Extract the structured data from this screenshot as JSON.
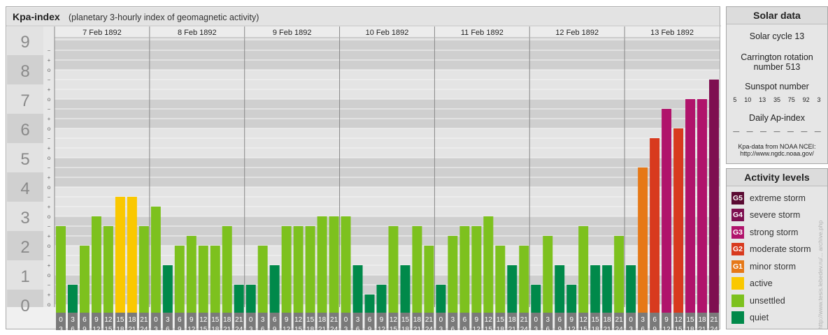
{
  "header": {
    "title": "Kpa-index",
    "subtitle": "(planetary 3-hourly index of geomagnetic activity)"
  },
  "solar_panel": {
    "title": "Solar data",
    "solar_cycle": "Solar cycle 13",
    "carrington_line1": "Carrington rotation",
    "carrington_line2": "number 513",
    "sunspot_title": "Sunspot number",
    "sunspot_values": [
      "5",
      "10",
      "13",
      "35",
      "75",
      "92",
      "3"
    ],
    "ap_title": "Daily Ap-index",
    "ap_values": [
      "—",
      "—",
      "—",
      "—",
      "—",
      "—",
      "—"
    ],
    "source_line1": "Kpa-data from NOAA NCEI:",
    "source_line2": "http://www.ngdc.noaa.gov/"
  },
  "legend": {
    "title": "Activity levels",
    "items": [
      {
        "badge": "G5",
        "label": "extreme storm",
        "color": "#5a0a32"
      },
      {
        "badge": "G4",
        "label": "severe storm",
        "color": "#7e0f50"
      },
      {
        "badge": "G3",
        "label": "strong storm",
        "color": "#b0136b"
      },
      {
        "badge": "G2",
        "label": "moderate storm",
        "color": "#d83a1e"
      },
      {
        "badge": "G1",
        "label": "minor storm",
        "color": "#e67817"
      },
      {
        "badge": "",
        "label": "active",
        "color": "#fac800"
      },
      {
        "badge": "",
        "label": "unsettled",
        "color": "#7dc11e"
      },
      {
        "badge": "",
        "label": "quiet",
        "color": "#00894a"
      }
    ]
  },
  "credit": "http://www.tesis.lebedev.ru/... archive.php",
  "chart_data": {
    "type": "bar",
    "title": "Kpa-index",
    "ylim": [
      0,
      9
    ],
    "y_major_ticks": [
      "0",
      "1",
      "2",
      "3",
      "4",
      "5",
      "6",
      "7",
      "8",
      "9"
    ],
    "y_minor_ticks": [
      "o",
      "+",
      "−"
    ],
    "days": [
      "7 Feb 1892",
      "8 Feb 1892",
      "9 Feb 1892",
      "10 Feb 1892",
      "11 Feb 1892",
      "12 Feb 1892",
      "13 Feb 1892"
    ],
    "interval_labels_top": [
      "0",
      "3",
      "6",
      "9",
      "12",
      "15",
      "18",
      "21"
    ],
    "interval_labels_bottom": [
      "3",
      "6",
      "9",
      "12",
      "15",
      "18",
      "21",
      "24"
    ],
    "values": [
      2.667,
      0.667,
      2.0,
      3.0,
      2.667,
      3.667,
      3.667,
      2.667,
      3.333,
      1.333,
      2.0,
      2.333,
      2.0,
      2.0,
      2.667,
      0.667,
      0.667,
      2.0,
      1.333,
      2.667,
      2.667,
      2.667,
      3.0,
      3.0,
      3.0,
      1.333,
      0.333,
      0.667,
      2.667,
      1.333,
      2.667,
      2.0,
      0.667,
      2.333,
      2.667,
      2.667,
      3.0,
      2.0,
      1.333,
      2.0,
      0.667,
      2.333,
      1.333,
      0.667,
      2.667,
      1.333,
      1.333,
      2.333,
      1.333,
      4.667,
      5.667,
      6.667,
      6.0,
      7.0,
      7.0,
      7.667
    ],
    "level_colors": {
      "quiet": "#00894a",
      "unsettled": "#7dc11e",
      "active": "#fac800",
      "G1": "#e67817",
      "G2": "#d83a1e",
      "G3": "#b0136b",
      "G4": "#7e0f50",
      "G5": "#5a0a32"
    }
  }
}
